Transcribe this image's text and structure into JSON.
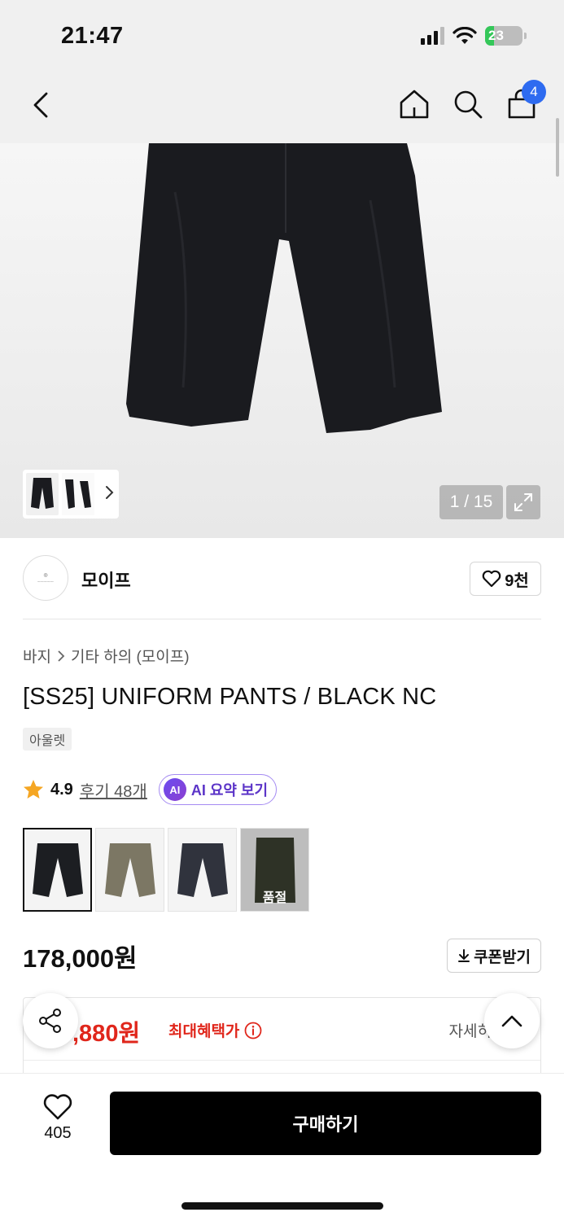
{
  "status_bar": {
    "time": "21:47",
    "battery": "23"
  },
  "nav": {
    "cart_count": "4"
  },
  "hero": {
    "image_counter": "1 / 15"
  },
  "brand": {
    "name": "모이프",
    "likes": "9천"
  },
  "breadcrumb": {
    "category": "바지",
    "subcategory": "기타 하의 (모이프)"
  },
  "product": {
    "title": "[SS25] UNIFORM PANTS / BLACK NC",
    "tag": "아울렛",
    "rating": "4.9",
    "reviews": "후기 48개",
    "ai_summary": "AI 요약 보기",
    "ai_badge": "AI",
    "price": "178,000원",
    "coupon_label": "쿠폰받기"
  },
  "swatches": [
    {
      "color": "#1c1e22",
      "selected": true
    },
    {
      "color": "#7c7764"
    },
    {
      "color": "#30333d"
    },
    {
      "color": "#2e3226",
      "soldout_label": "품절"
    }
  ],
  "benefit": {
    "price": ",880원",
    "label": "최대혜택가",
    "detail": "자세히"
  },
  "bottom": {
    "wish_count": "405",
    "buy_label": "구매하기"
  },
  "colors": {
    "accent_red": "#e0261b",
    "badge_blue": "#2e6bf0",
    "ai_purple": "#5c35c8"
  }
}
